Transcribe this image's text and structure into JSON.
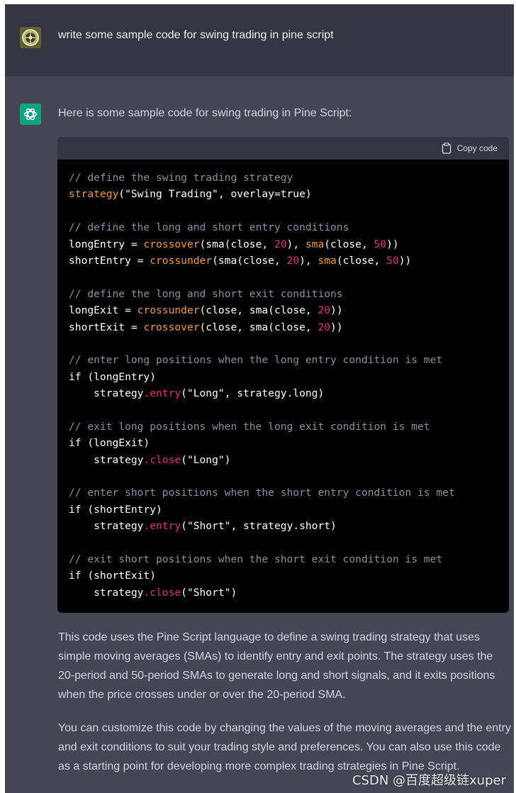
{
  "user": {
    "message": "write some sample code for swing trading in pine script"
  },
  "assistant": {
    "intro": "Here is some sample code for swing trading in Pine Script:",
    "copy_label": "Copy code",
    "code_lines": [
      [
        {
          "t": "// define the swing trading strategy",
          "c": "com"
        }
      ],
      [
        {
          "t": "strategy",
          "c": "fn"
        },
        {
          "t": "(\"Swing Trading\", overlay=true)",
          "c": ""
        }
      ],
      [],
      [
        {
          "t": "// define the long and short entry conditions",
          "c": "com"
        }
      ],
      [
        {
          "t": "longEntry = ",
          "c": ""
        },
        {
          "t": "crossover",
          "c": "fn"
        },
        {
          "t": "(sma(close, ",
          "c": ""
        },
        {
          "t": "20",
          "c": "num"
        },
        {
          "t": "), ",
          "c": ""
        },
        {
          "t": "sma",
          "c": "fn"
        },
        {
          "t": "(close, ",
          "c": ""
        },
        {
          "t": "50",
          "c": "num"
        },
        {
          "t": "))",
          "c": ""
        }
      ],
      [
        {
          "t": "shortEntry = ",
          "c": ""
        },
        {
          "t": "crossunder",
          "c": "fn"
        },
        {
          "t": "(sma(close, ",
          "c": ""
        },
        {
          "t": "20",
          "c": "num"
        },
        {
          "t": "), ",
          "c": ""
        },
        {
          "t": "sma",
          "c": "fn"
        },
        {
          "t": "(close, ",
          "c": ""
        },
        {
          "t": "50",
          "c": "num"
        },
        {
          "t": "))",
          "c": ""
        }
      ],
      [],
      [
        {
          "t": "// define the long and short exit conditions",
          "c": "com"
        }
      ],
      [
        {
          "t": "longExit = ",
          "c": ""
        },
        {
          "t": "crossunder",
          "c": "fn"
        },
        {
          "t": "(close, sma(close, ",
          "c": ""
        },
        {
          "t": "20",
          "c": "num"
        },
        {
          "t": "))",
          "c": ""
        }
      ],
      [
        {
          "t": "shortExit = ",
          "c": ""
        },
        {
          "t": "crossover",
          "c": "fn"
        },
        {
          "t": "(close, sma(close, ",
          "c": ""
        },
        {
          "t": "20",
          "c": "num"
        },
        {
          "t": "))",
          "c": ""
        }
      ],
      [],
      [
        {
          "t": "// enter long positions when the long entry condition is met",
          "c": "com"
        }
      ],
      [
        {
          "t": "if (longEntry)",
          "c": ""
        }
      ],
      [
        {
          "t": "    strategy",
          "c": ""
        },
        {
          "t": ".entry",
          "c": "meth"
        },
        {
          "t": "(\"Long\", strategy.long)",
          "c": ""
        }
      ],
      [],
      [
        {
          "t": "// exit long positions when the long exit condition is met",
          "c": "com"
        }
      ],
      [
        {
          "t": "if (longExit)",
          "c": ""
        }
      ],
      [
        {
          "t": "    strategy",
          "c": ""
        },
        {
          "t": ".close",
          "c": "meth"
        },
        {
          "t": "(\"Long\")",
          "c": ""
        }
      ],
      [],
      [
        {
          "t": "// enter short positions when the short entry condition is met",
          "c": "com"
        }
      ],
      [
        {
          "t": "if (shortEntry)",
          "c": ""
        }
      ],
      [
        {
          "t": "    strategy",
          "c": ""
        },
        {
          "t": ".entry",
          "c": "meth"
        },
        {
          "t": "(\"Short\", strategy.short)",
          "c": ""
        }
      ],
      [],
      [
        {
          "t": "// exit short positions when the short exit condition is met",
          "c": "com"
        }
      ],
      [
        {
          "t": "if (shortExit)",
          "c": ""
        }
      ],
      [
        {
          "t": "    strategy",
          "c": ""
        },
        {
          "t": ".close",
          "c": "meth"
        },
        {
          "t": "(\"Short\")",
          "c": ""
        }
      ]
    ],
    "paragraph_1": "This code uses the Pine Script language to define a swing trading strategy that uses simple moving averages (SMAs) to identify entry and exit points. The strategy uses the 20-period and 50-period SMAs to generate long and short signals, and it exits positions when the price crosses under or over the 20-period SMA.",
    "paragraph_2": "You can customize this code by changing the values of the moving averages and the entry and exit conditions to suit your trading style and preferences. You can also use this code as a starting point for developing more complex trading strategies in Pine Script."
  },
  "watermark": "CSDN @百度超级链xuper",
  "colors": {
    "user_bg": "#343541",
    "assistant_bg": "#444654",
    "code_bg": "#000000",
    "brand_green": "#10a37f",
    "syntax_function": "#f29d2d",
    "syntax_number": "#df3079",
    "syntax_comment": "#8e8ea0"
  },
  "icons": {
    "user_avatar": "user-avatar-image",
    "assistant_avatar": "openai-logo-icon",
    "copy": "clipboard-icon"
  }
}
